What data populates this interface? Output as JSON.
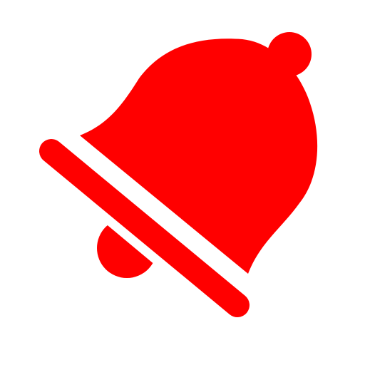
{
  "icon": {
    "name": "bell-slash-icon",
    "color": "#ff0000",
    "background": "#ffffff"
  }
}
